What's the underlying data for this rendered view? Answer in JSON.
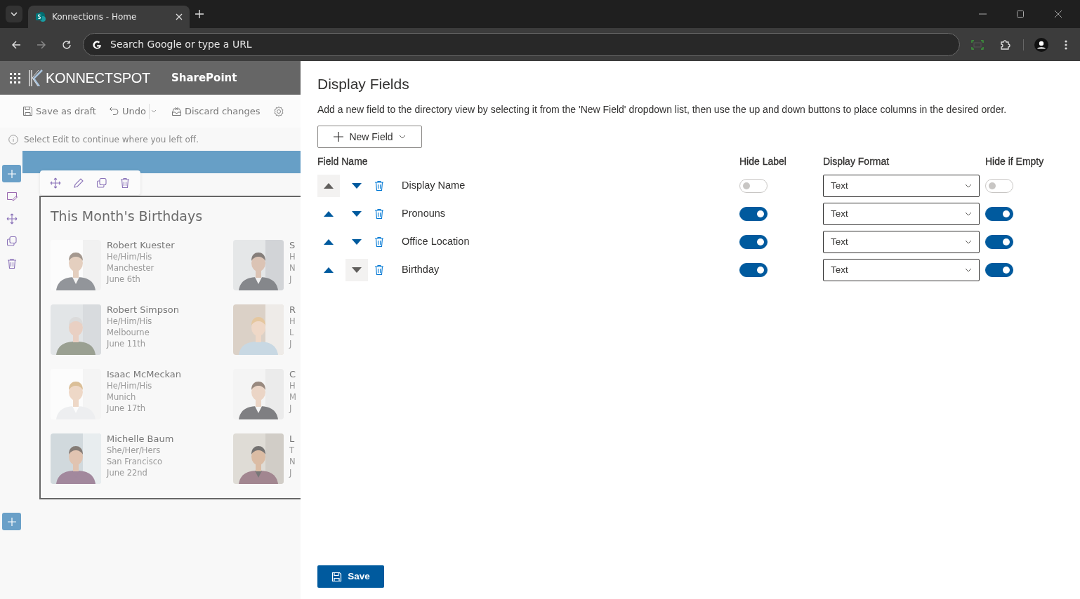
{
  "browser": {
    "tab_title": "Konnections - Home",
    "address_placeholder": "Search Google or type a URL"
  },
  "suite_bar": {
    "logo_text": "KONNECTSPOT",
    "app_name": "SharePoint"
  },
  "command_bar": [
    {
      "kind": "save",
      "label": "Save as draft"
    },
    {
      "kind": "undo",
      "label": "Undo"
    },
    {
      "kind": "discard",
      "label": "Discard changes"
    }
  ],
  "info_message": "Select Edit to continue where you left off.",
  "webpart": {
    "title": "This Month's Birthdays",
    "people": [
      {
        "name": "Robert Kuester",
        "pronouns": "He/Him/His",
        "location": "Manchester",
        "birthday": "June 6th"
      },
      {
        "name": "Robert Simpson",
        "pronouns": "He/Him/His",
        "location": "Melbourne",
        "birthday": "June 11th"
      },
      {
        "name": "Isaac McMeckan",
        "pronouns": "He/Him/His",
        "location": "Munich",
        "birthday": "June 17th"
      },
      {
        "name": "Michelle Baum",
        "pronouns": "She/Her/Hers",
        "location": "San Francisco",
        "birthday": "June 22nd"
      }
    ],
    "people_cut_off": [
      {
        "name": "S",
        "pronouns": "H",
        "location": "N",
        "birthday": "J"
      },
      {
        "name": "R",
        "pronouns": "H",
        "location": "L",
        "birthday": "J"
      },
      {
        "name": "C",
        "pronouns": "H",
        "location": "M",
        "birthday": "J"
      },
      {
        "name": "L",
        "pronouns": "T",
        "location": "N",
        "birthday": "J"
      }
    ]
  },
  "panel": {
    "title": "Display Fields",
    "description": "Add a new field to the directory view by selecting it from the 'New Field' dropdown list, then use the up and down buttons to place columns in the desired order.",
    "new_field_button": "New Field",
    "columns": [
      "Field Name",
      "Hide Label",
      "Display Format",
      "Hide if Empty"
    ],
    "rows": [
      {
        "field_name": "Display Name",
        "up_disabled": true,
        "down_disabled": false,
        "hide_label": false,
        "display_format": "Text",
        "hide_if_empty": false
      },
      {
        "field_name": "Pronouns",
        "up_disabled": false,
        "down_disabled": false,
        "hide_label": true,
        "display_format": "Text",
        "hide_if_empty": true
      },
      {
        "field_name": "Office Location",
        "up_disabled": false,
        "down_disabled": false,
        "hide_label": true,
        "display_format": "Text",
        "hide_if_empty": true
      },
      {
        "field_name": "Birthday",
        "up_disabled": false,
        "down_disabled": true,
        "hide_label": true,
        "display_format": "Text",
        "hide_if_empty": true
      }
    ],
    "save_button": "Save"
  }
}
